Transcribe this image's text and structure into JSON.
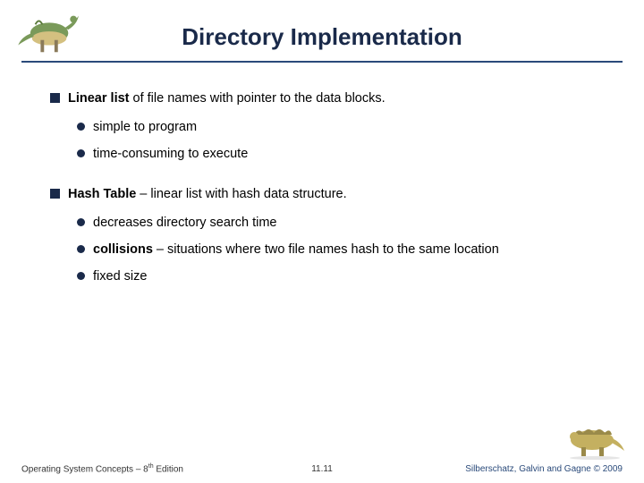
{
  "title": "Directory Implementation",
  "bullets": {
    "b1_bold": "Linear list",
    "b1_rest": " of file names with pointer to the data blocks.",
    "b1_s1": "simple to program",
    "b1_s2": "time-consuming to execute",
    "b2_bold": "Hash Table",
    "b2_rest": " – linear list with hash data structure.",
    "b2_s1": "decreases directory search time",
    "b2_s2_bold": "collisions",
    "b2_s2_rest": " – situations where two file names hash to the same location",
    "b2_s3": "fixed size"
  },
  "footer": {
    "left_pre": "Operating System Concepts – 8",
    "left_sup": "th",
    "left_post": " Edition",
    "center": "11.11",
    "right": "Silberschatz, Galvin and Gagne © 2009"
  }
}
